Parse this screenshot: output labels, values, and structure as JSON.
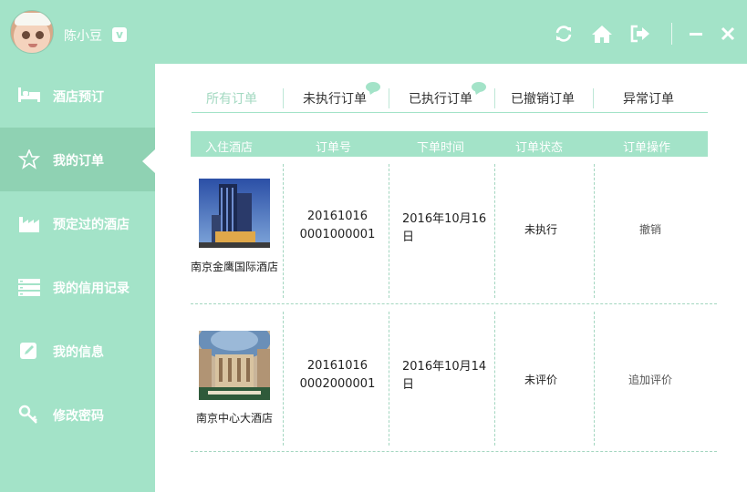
{
  "user": {
    "name": "陈小豆",
    "badge": "v"
  },
  "topbar": {
    "icons": [
      "refresh-icon",
      "home-icon",
      "logout-icon",
      "minimize-icon",
      "close-icon"
    ]
  },
  "sidebar": {
    "items": [
      {
        "label": "酒店预订",
        "icon": "bed-icon"
      },
      {
        "label": "我的订单",
        "icon": "star-icon"
      },
      {
        "label": "预定过的酒店",
        "icon": "building-icon"
      },
      {
        "label": "我的信用记录",
        "icon": "list-icon"
      },
      {
        "label": "我的信息",
        "icon": "edit-icon"
      },
      {
        "label": "修改密码",
        "icon": "key-icon"
      }
    ]
  },
  "tabs": [
    "所有订单",
    "未执行订单",
    "已执行订单",
    "已撤销订单",
    "异常订单"
  ],
  "table": {
    "headers": [
      "入住酒店",
      "订单号",
      "下单时间",
      "订单状态",
      "订单操作"
    ],
    "rows": [
      {
        "hotel": "南京金鹰国际酒店",
        "order_no_1": "20161016",
        "order_no_2": "0001000001",
        "date_1": "2016年10月16",
        "date_2": "日",
        "status": "未执行",
        "action": "撤销"
      },
      {
        "hotel": "南京中心大酒店",
        "order_no_1": "20161016",
        "order_no_2": "0002000001",
        "date_1": "2016年10月14",
        "date_2": "日",
        "status": "未评价",
        "action": "追加评价"
      }
    ]
  },
  "colors": {
    "accent": "#a3e3c8",
    "active_item": "#8fd2b3",
    "white": "#ffffff"
  }
}
